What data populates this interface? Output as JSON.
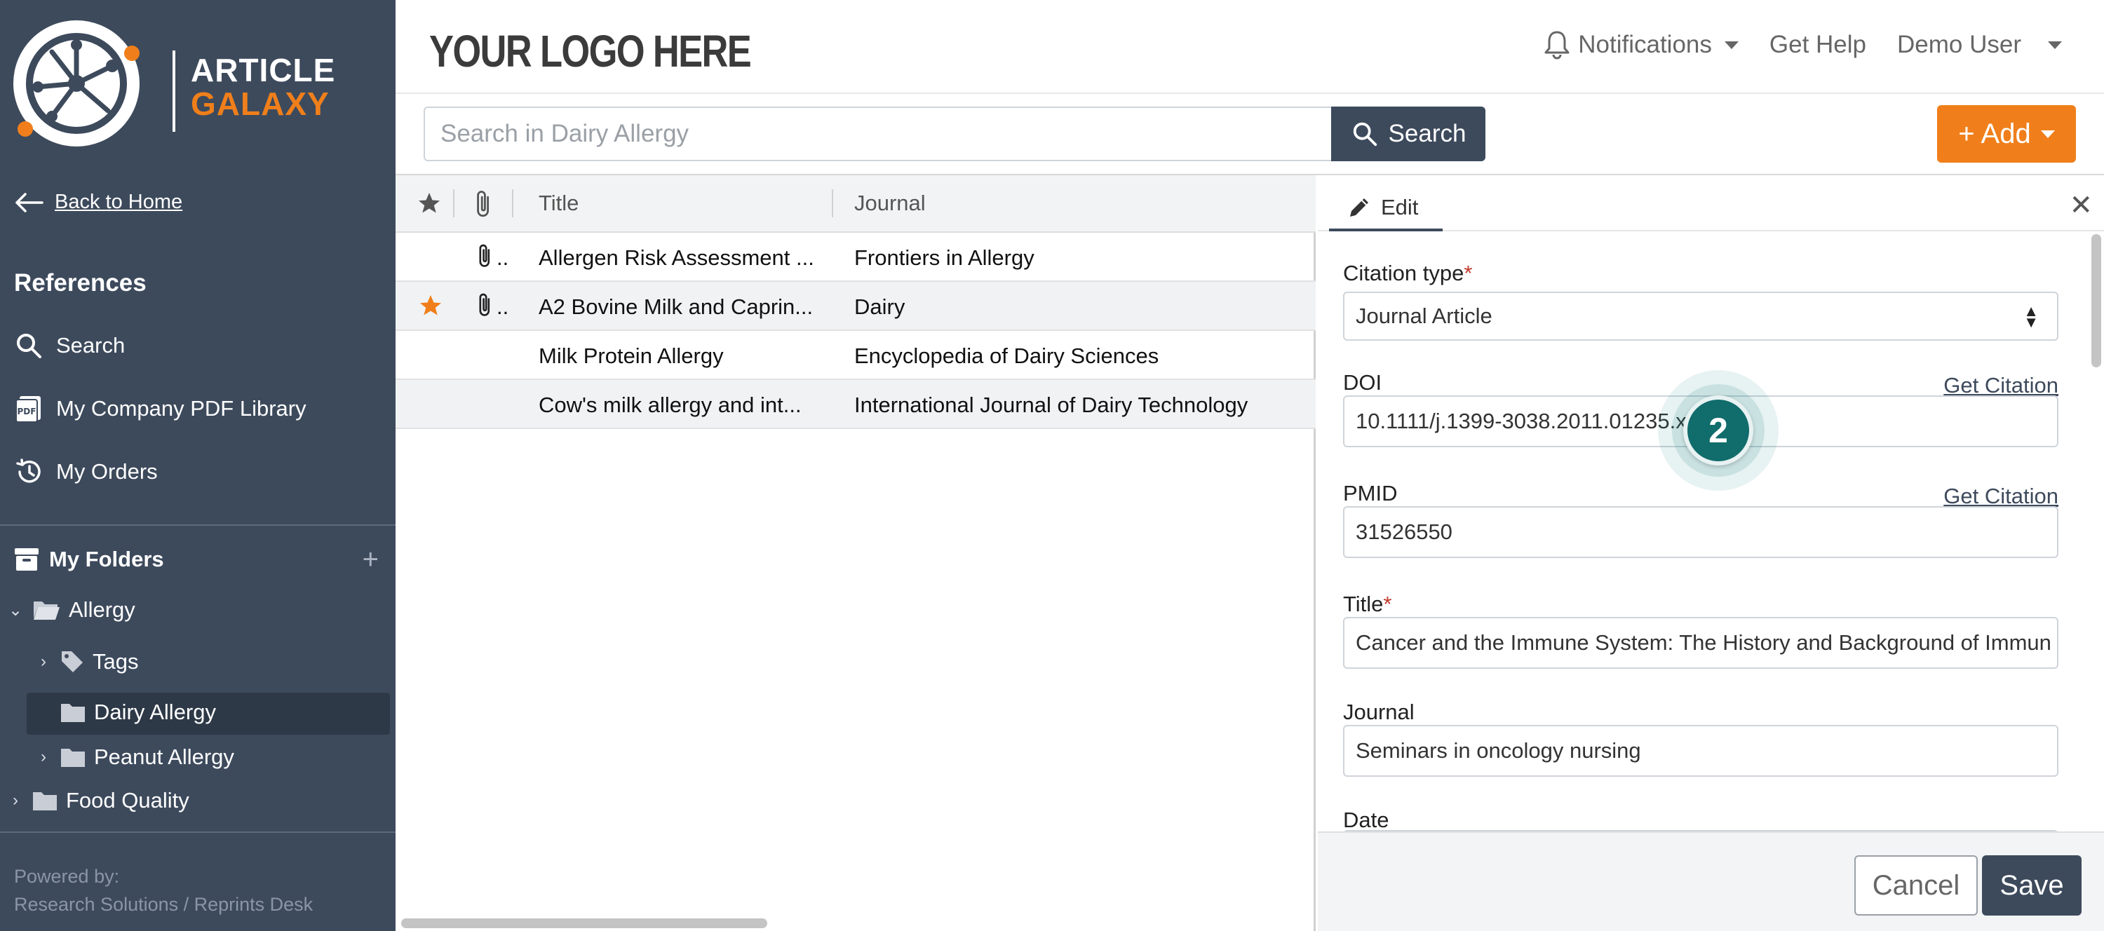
{
  "brand": {
    "line1": "ARTICLE",
    "line2": "GALAXY",
    "logo_placeholder": "YOUR LOGO HERE"
  },
  "sidebar": {
    "back_label": "Back to Home",
    "references_heading": "References",
    "nav": [
      {
        "label": "Search",
        "icon": "search-icon"
      },
      {
        "label": "My Company PDF Library",
        "icon": "pdf-icon"
      },
      {
        "label": "My Orders",
        "icon": "history-icon"
      }
    ],
    "folders_heading": "My Folders",
    "folders": [
      {
        "label": "Allergy",
        "expanded": true
      },
      {
        "label": "Tags",
        "expanded": false
      },
      {
        "label": "Dairy Allergy",
        "selected": true
      },
      {
        "label": "Peanut Allergy",
        "expanded": false
      },
      {
        "label": "Food Quality",
        "expanded": false
      }
    ],
    "powered_line1": "Powered by:",
    "powered_line2": "Research Solutions / Reprints Desk"
  },
  "header": {
    "notifications_label": "Notifications",
    "help_label": "Get Help",
    "user_label": "Demo User"
  },
  "search": {
    "placeholder": "Search in Dairy Allergy",
    "button_label": "Search",
    "add_label": "+ Add"
  },
  "table": {
    "columns": {
      "title": "Title",
      "journal": "Journal"
    },
    "rows": [
      {
        "title": "Allergen Risk Assessment ...",
        "journal": "Frontiers in Allergy",
        "starred": false,
        "attachment": true
      },
      {
        "title": "A2 Bovine Milk and Caprin...",
        "journal": "Dairy",
        "starred": true,
        "attachment": true
      },
      {
        "title": "Milk Protein Allergy",
        "journal": "Encyclopedia of Dairy Sciences",
        "starred": false,
        "attachment": false
      },
      {
        "title": "Cow's milk allergy and int...",
        "journal": "International Journal of Dairy Technology",
        "starred": false,
        "attachment": false
      }
    ]
  },
  "panel": {
    "tab_label": "Edit",
    "citation_type_label": "Citation type",
    "citation_type_value": "Journal Article",
    "doi_label": "DOI",
    "doi_value": "10.1111/j.1399-3038.2011.01235.x",
    "pmid_label": "PMID",
    "pmid_value": "31526550",
    "get_citation_label": "Get Citation",
    "title_label": "Title",
    "title_value": "Cancer and the Immune System: The History and Background of Immun",
    "journal_label": "Journal",
    "journal_value": "Seminars in oncology nursing",
    "date_label": "Date",
    "cancel_label": "Cancel",
    "save_label": "Save"
  },
  "step_badge": "2",
  "colors": {
    "sidebar": "#3d4a5c",
    "accent": "#f07f1b",
    "badge": "#116c6c"
  }
}
